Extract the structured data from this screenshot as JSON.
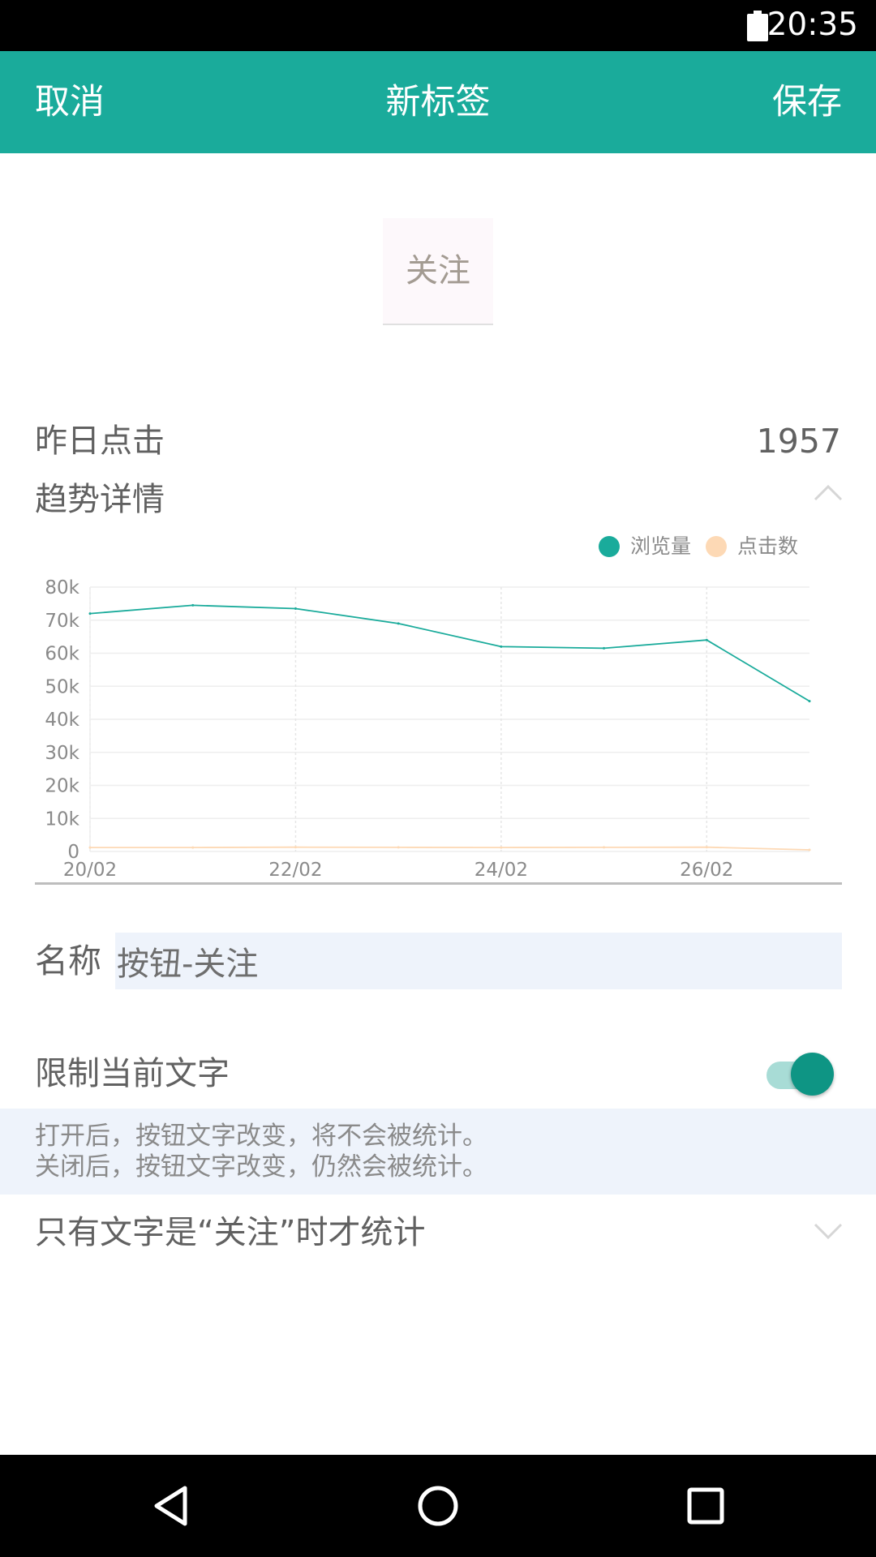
{
  "status_bar": {
    "time": "20:35",
    "battery_icon": "battery-icon"
  },
  "app_bar": {
    "cancel_label": "取消",
    "title": "新标签",
    "save_label": "保存",
    "background": "#1aab9b"
  },
  "tag_preview": {
    "text": "关注"
  },
  "stats": {
    "yesterday_clicks_label": "昨日点击",
    "yesterday_clicks_value": "1957",
    "trend_label": "趋势详情",
    "trend_toggle_icon": "chevron-up-icon"
  },
  "chart_data": {
    "type": "line",
    "categories": [
      "20/02",
      "21/02",
      "22/02",
      "23/02",
      "24/02",
      "25/02",
      "26/02",
      "27/02"
    ],
    "x_tick_labels": [
      "20/02",
      "22/02",
      "24/02",
      "26/02"
    ],
    "y_tick_labels": [
      "0",
      "10k",
      "20k",
      "30k",
      "40k",
      "50k",
      "60k",
      "70k",
      "80k"
    ],
    "ylim": [
      0,
      80000
    ],
    "grid": true,
    "legend_position": "top-right",
    "series": [
      {
        "name": "浏览量",
        "color": "#1aab9b",
        "values": [
          72000,
          74500,
          73500,
          69000,
          62000,
          61500,
          64000,
          45500
        ]
      },
      {
        "name": "点击数",
        "color": "#fdd9b5",
        "values": [
          1200,
          1200,
          1300,
          1250,
          1200,
          1250,
          1300,
          500
        ]
      }
    ]
  },
  "form": {
    "name_label": "名称",
    "name_value": "按钮-关注",
    "restrict_label": "限制当前文字",
    "restrict_enabled": true,
    "hint_line1": "打开后，按钮文字改变，将不会被统计。",
    "hint_line2": "关闭后，按钮文字改变，仍然会被统计。",
    "condition_label": "只有文字是“关注”时才统计",
    "condition_icon": "chevron-down-icon"
  },
  "nav_bar": {
    "back_icon": "back-icon",
    "home_icon": "home-icon",
    "recents_icon": "recents-icon"
  }
}
